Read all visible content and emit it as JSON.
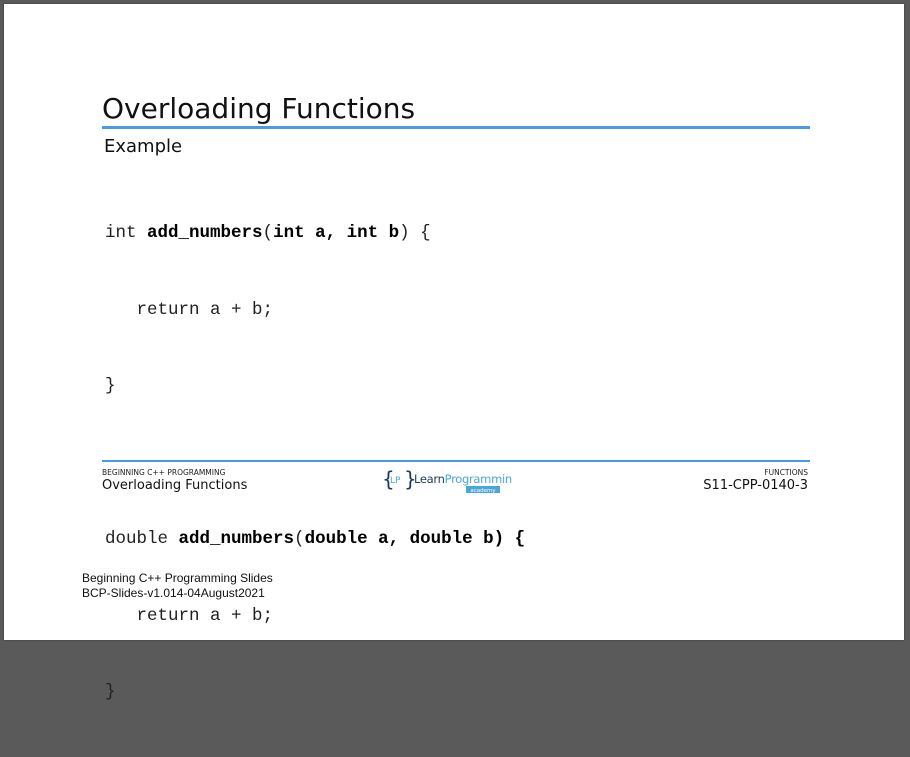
{
  "slide": {
    "title": "Overloading Functions",
    "subtitle": "Example",
    "code": {
      "line1_kw": "int ",
      "line1_fn": "add_numbers",
      "line1_open": "(",
      "line1_params": "int a, int b",
      "line1_close": ") {",
      "line2": "   return a + b;",
      "line3": "}",
      "line5_kw": "double ",
      "line5_fn": "add_numbers",
      "line5_open": "(",
      "line5_params": "double a, double b) {",
      "line6": "   return a + b;",
      "line7": "}"
    }
  },
  "footer": {
    "course_label": "BEGINNING C++ PROGRAMMING",
    "slide_name": "Overloading Functions",
    "section_label": "FUNCTIONS",
    "slide_code": "S11-CPP-0140-3",
    "logo": {
      "brace_left": "{",
      "brace_right": "}",
      "monogram": "LP",
      "text_learn": "Learn",
      "text_programming": "Programming",
      "tagline": "academy",
      "color_dark": "#1b3a5a",
      "color_accent": "#4aa8d8"
    }
  },
  "document_note": {
    "line1": "Beginning C++ Programming Slides",
    "line2": "BCP-Slides-v1.014-04August2021"
  },
  "colors": {
    "accent_rule": "#4a9ae6",
    "background": "#5a5a5a",
    "page": "#ffffff"
  }
}
